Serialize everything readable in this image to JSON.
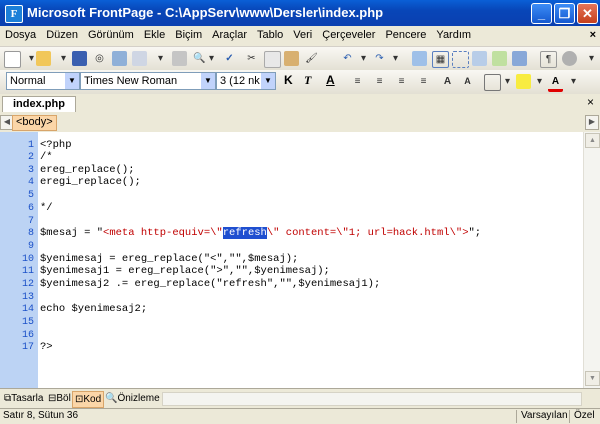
{
  "window": {
    "title": "Microsoft FrontPage - C:\\AppServ\\www\\Dersler\\index.php",
    "minimize": "_",
    "maximize": "❐",
    "close": "✕"
  },
  "menu": {
    "items": [
      "Dosya",
      "Düzen",
      "Görünüm",
      "Ekle",
      "Biçim",
      "Araçlar",
      "Tablo",
      "Veri",
      "Çerçeveler",
      "Pencere",
      "Yardım"
    ],
    "close": "×"
  },
  "format": {
    "style": "Normal",
    "font": "Times New Roman",
    "size": "3  (12 nk",
    "bold": "K",
    "italic": "T",
    "underline": "A"
  },
  "tabs": {
    "active": "index.php",
    "close": "×"
  },
  "tagbar": {
    "tag": "<body>"
  },
  "editor": {
    "line_numbers": [
      "1",
      "2",
      "3",
      "4",
      "5",
      "6",
      "7",
      "8",
      "9",
      "10",
      "11",
      "12",
      "13",
      "14",
      "15",
      "16",
      "17"
    ],
    "lines": [
      "<?php",
      "/*",
      "ereg_replace();",
      "eregi_replace();",
      "",
      "*/",
      "",
      "",
      "",
      "$yenimesaj = ereg_replace(\"<\",\"\",$mesaj);",
      "$yenimesaj1 = ereg_replace(\">\",\"\",$yenimesaj);",
      "$yenimesaj2 .= ereg_replace(\"refresh\",\"\",$yenimesaj1);",
      "",
      "echo $yenimesaj2;",
      "",
      "",
      "?>"
    ],
    "line8": {
      "prefix": "$mesaj = \"",
      "part1": "<meta http-equiv=\\\"",
      "selected": "refresh",
      "part2": "\\\" content=\\\"1; url=hack.html\\\">",
      "suffix": "\";"
    }
  },
  "views": {
    "design": "Tasarla",
    "split": "Böl",
    "code": "Kod",
    "preview": "Önizleme"
  },
  "status": {
    "position": "Satır 8, Sütun 36",
    "mode": "Varsayılan",
    "custom": "Özel"
  }
}
